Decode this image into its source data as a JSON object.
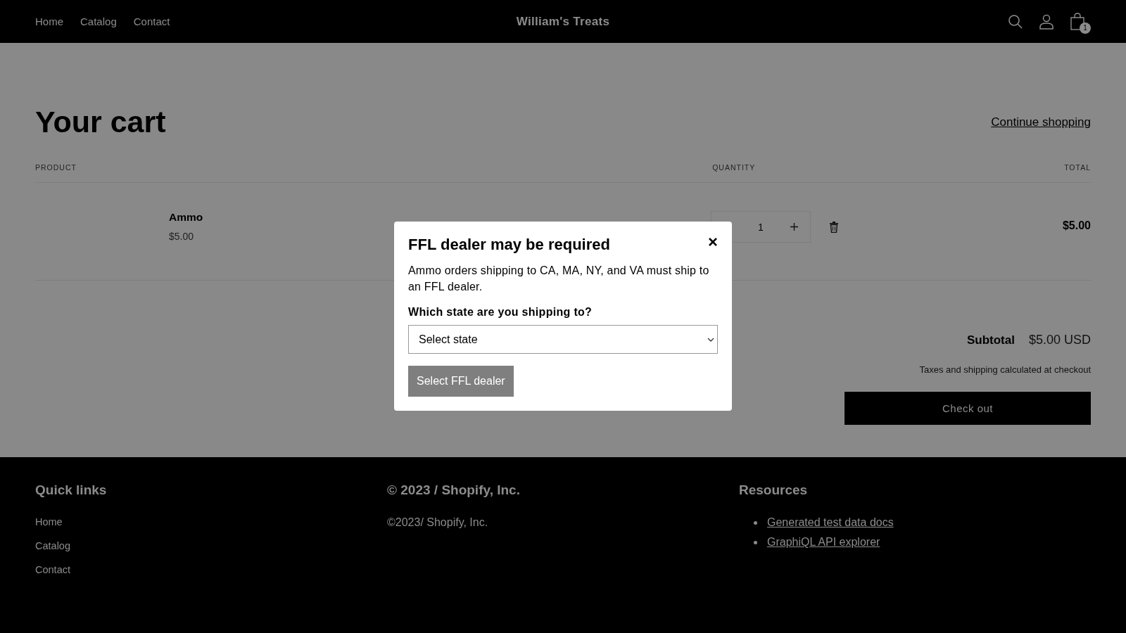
{
  "header": {
    "nav": [
      "Home",
      "Catalog",
      "Contact"
    ],
    "brand": "William's Treats",
    "cart_count": "1"
  },
  "cart": {
    "title": "Your cart",
    "continue_link": "Continue shopping",
    "columns": [
      "PRODUCT",
      "QUANTITY",
      "TOTAL"
    ],
    "items": [
      {
        "name": "Ammo",
        "price": "$5.00",
        "quantity": "1",
        "total": "$5.00"
      }
    ],
    "subtotal_label": "Subtotal",
    "subtotal": "$5.00 USD",
    "tax_note": "Taxes and shipping calculated at checkout",
    "checkout": "Check out"
  },
  "modal": {
    "title": "FFL dealer may be required",
    "body": "Ammo orders shipping to CA, MA, NY, and VA must ship to an FFL dealer.",
    "question": "Which state are you shipping to?",
    "select_placeholder": "Select state",
    "button": "Select FFL dealer"
  },
  "footer": {
    "quick_links_title": "Quick links",
    "quick_links": [
      "Home",
      "Catalog",
      "Contact"
    ],
    "copyright_title": "© 2023 / Shopify, Inc.",
    "copyright_text": "©2023/ Shopify, Inc.",
    "resources_title": "Resources",
    "resources": [
      "Generated test data docs",
      "GraphiQL API explorer"
    ]
  }
}
